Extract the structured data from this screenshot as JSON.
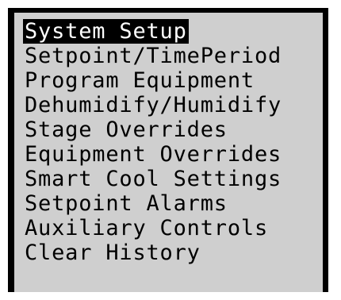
{
  "menu": {
    "selected_index": 0,
    "items": [
      {
        "label": "System Setup"
      },
      {
        "label": "Setpoint/TimePeriod"
      },
      {
        "label": "Program Equipment"
      },
      {
        "label": "Dehumidify/Humidify"
      },
      {
        "label": "Stage Overrides"
      },
      {
        "label": "Equipment Overrides"
      },
      {
        "label": "Smart Cool Settings"
      },
      {
        "label": "Setpoint Alarms"
      },
      {
        "label": "Auxiliary Controls"
      },
      {
        "label": "Clear History"
      }
    ]
  },
  "colors": {
    "screen_background": "#cfcfcf",
    "border": "#000000",
    "text": "#000000",
    "highlight_background": "#000000",
    "highlight_text": "#ffffff"
  }
}
